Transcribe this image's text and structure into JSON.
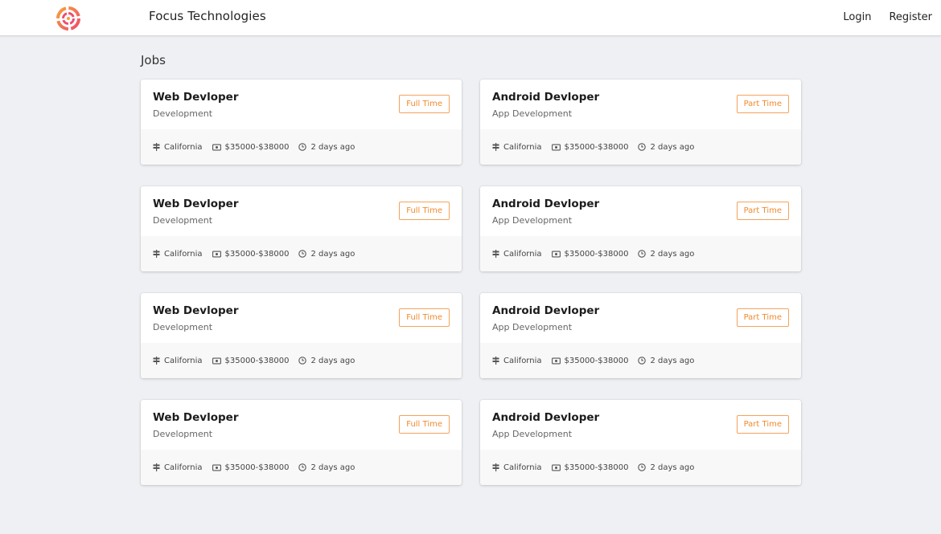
{
  "navbar": {
    "brand": "Focus Technologies",
    "links": [
      "Login",
      "Register"
    ]
  },
  "main": {
    "heading": "Jobs",
    "jobs": [
      {
        "title": "Web Devloper",
        "department": "Development",
        "type": "Full Time",
        "location": "California",
        "salary": "$35000-$38000",
        "posted": "2 days ago"
      },
      {
        "title": "Android Devloper",
        "department": "App Development",
        "type": "Part Time",
        "location": "California",
        "salary": "$35000-$38000",
        "posted": "2 days ago"
      },
      {
        "title": "Web Devloper",
        "department": "Development",
        "type": "Full Time",
        "location": "California",
        "salary": "$35000-$38000",
        "posted": "2 days ago"
      },
      {
        "title": "Android Devloper",
        "department": "App Development",
        "type": "Part Time",
        "location": "California",
        "salary": "$35000-$38000",
        "posted": "2 days ago"
      },
      {
        "title": "Web Devloper",
        "department": "Development",
        "type": "Full Time",
        "location": "California",
        "salary": "$35000-$38000",
        "posted": "2 days ago"
      },
      {
        "title": "Android Devloper",
        "department": "App Development",
        "type": "Part Time",
        "location": "California",
        "salary": "$35000-$38000",
        "posted": "2 days ago"
      },
      {
        "title": "Web Devloper",
        "department": "Development",
        "type": "Full Time",
        "location": "California",
        "salary": "$35000-$38000",
        "posted": "2 days ago"
      },
      {
        "title": "Android Devloper",
        "department": "App Development",
        "type": "Part Time",
        "location": "California",
        "salary": "$35000-$38000",
        "posted": "2 days ago"
      }
    ]
  },
  "icons": {
    "logo": "target-logo-icon",
    "location": "signpost-icon",
    "salary": "money-icon",
    "posted": "clock-icon"
  },
  "colors": {
    "accent": "#f08a2e",
    "logo_pink": "#ef4b6c",
    "logo_orange": "#f7a13b",
    "background": "#eef0f3"
  }
}
